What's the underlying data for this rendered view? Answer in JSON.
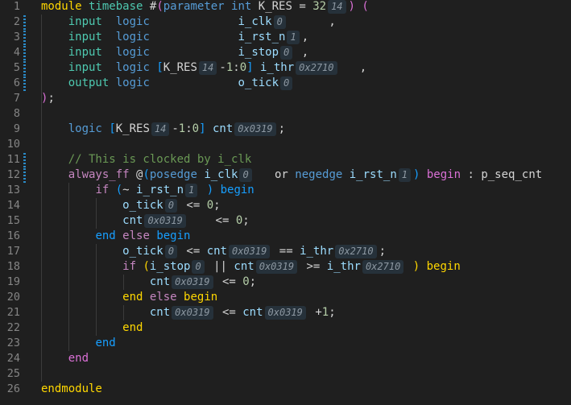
{
  "editor": {
    "language": "systemverilog",
    "colors": {
      "background": "#1f1f1f",
      "line_number": "#858585",
      "keyword": "#569cd6",
      "control": "#c586c0",
      "type": "#4ec9b0",
      "variable": "#9cdcfe",
      "number": "#b5cea8",
      "comment": "#6a9955",
      "bracket1": "#ffd700",
      "bracket2": "#da70d6",
      "bracket3": "#179fff",
      "inlay_hint_bg": "#26313a"
    },
    "modified_lines": [
      2,
      3,
      4,
      5,
      6,
      11,
      12
    ],
    "lines": [
      [
        [
          "b1",
          "module"
        ],
        [
          "p",
          " "
        ],
        [
          "t",
          "timebase"
        ],
        [
          "p",
          " #"
        ],
        [
          "b2",
          "("
        ],
        [
          "k",
          "parameter"
        ],
        [
          "p",
          " "
        ],
        [
          "k",
          "int"
        ],
        [
          "p",
          " K_RES = "
        ],
        [
          "n",
          "32"
        ],
        [
          "h",
          "14"
        ],
        [
          "b2",
          ")"
        ],
        [
          "p",
          " "
        ],
        [
          "b2",
          "("
        ]
      ],
      [
        [
          "p",
          "    "
        ],
        [
          "t",
          "input"
        ],
        [
          "p",
          "  "
        ],
        [
          "k",
          "logic"
        ],
        [
          "p",
          "             "
        ],
        [
          "v",
          "i_clk"
        ],
        [
          "h",
          "0"
        ],
        [
          "p",
          "      ,"
        ]
      ],
      [
        [
          "p",
          "    "
        ],
        [
          "t",
          "input"
        ],
        [
          "p",
          "  "
        ],
        [
          "k",
          "logic"
        ],
        [
          "p",
          "             "
        ],
        [
          "v",
          "i_rst_n"
        ],
        [
          "h",
          "1"
        ],
        [
          "p",
          ","
        ]
      ],
      [
        [
          "p",
          "    "
        ],
        [
          "t",
          "input"
        ],
        [
          "p",
          "  "
        ],
        [
          "k",
          "logic"
        ],
        [
          "p",
          "             "
        ],
        [
          "v",
          "i_stop"
        ],
        [
          "h",
          "0"
        ],
        [
          "p",
          " ,"
        ]
      ],
      [
        [
          "p",
          "    "
        ],
        [
          "t",
          "input"
        ],
        [
          "p",
          "  "
        ],
        [
          "k",
          "logic"
        ],
        [
          "p",
          " "
        ],
        [
          "b3",
          "["
        ],
        [
          "p",
          "K_RES"
        ],
        [
          "h",
          "14"
        ],
        [
          "p",
          "-"
        ],
        [
          "n",
          "1"
        ],
        [
          "p",
          ":"
        ],
        [
          "n",
          "0"
        ],
        [
          "b3",
          "]"
        ],
        [
          "p",
          " "
        ],
        [
          "v",
          "i_thr"
        ],
        [
          "h",
          "0x2710"
        ],
        [
          "p",
          "   ,"
        ]
      ],
      [
        [
          "p",
          "    "
        ],
        [
          "t",
          "output"
        ],
        [
          "p",
          " "
        ],
        [
          "k",
          "logic"
        ],
        [
          "p",
          "             "
        ],
        [
          "v",
          "o_tick"
        ],
        [
          "h",
          "0"
        ]
      ],
      [
        [
          "b2",
          ")"
        ],
        [
          "p",
          ";"
        ]
      ],
      [],
      [
        [
          "p",
          "    "
        ],
        [
          "k",
          "logic"
        ],
        [
          "p",
          " "
        ],
        [
          "b3",
          "["
        ],
        [
          "p",
          "K_RES"
        ],
        [
          "h",
          "14"
        ],
        [
          "p",
          "-"
        ],
        [
          "n",
          "1"
        ],
        [
          "p",
          ":"
        ],
        [
          "n",
          "0"
        ],
        [
          "b3",
          "]"
        ],
        [
          "p",
          " "
        ],
        [
          "v",
          "cnt"
        ],
        [
          "h",
          "0x0319"
        ],
        [
          "p",
          ";"
        ]
      ],
      [],
      [
        [
          "p",
          "    "
        ],
        [
          "c",
          "// This is clocked by i_clk"
        ]
      ],
      [
        [
          "p",
          "    "
        ],
        [
          "kp",
          "always_ff"
        ],
        [
          "p",
          " @"
        ],
        [
          "b3",
          "("
        ],
        [
          "k",
          "posedge"
        ],
        [
          "p",
          " "
        ],
        [
          "v",
          "i_clk"
        ],
        [
          "h",
          "0"
        ],
        [
          "p",
          "   or "
        ],
        [
          "k",
          "negedge"
        ],
        [
          "p",
          " "
        ],
        [
          "v",
          "i_rst_n"
        ],
        [
          "h",
          "1"
        ],
        [
          "b3",
          ")"
        ],
        [
          "p",
          " "
        ],
        [
          "b2",
          "begin"
        ],
        [
          "p",
          " : p_seq_cnt"
        ]
      ],
      [
        [
          "p",
          "        "
        ],
        [
          "kp",
          "if"
        ],
        [
          "p",
          " "
        ],
        [
          "b3",
          "("
        ],
        [
          "p",
          "~ "
        ],
        [
          "v",
          "i_rst_n"
        ],
        [
          "h",
          "1"
        ],
        [
          "p",
          " "
        ],
        [
          "b3",
          ")"
        ],
        [
          "p",
          " "
        ],
        [
          "b3",
          "begin"
        ]
      ],
      [
        [
          "p",
          "            "
        ],
        [
          "v",
          "o_tick"
        ],
        [
          "h",
          "0"
        ],
        [
          "p",
          " <= "
        ],
        [
          "n",
          "0"
        ],
        [
          "p",
          ";"
        ]
      ],
      [
        [
          "p",
          "            "
        ],
        [
          "v",
          "cnt"
        ],
        [
          "h",
          "0x0319"
        ],
        [
          "p",
          "    <= "
        ],
        [
          "n",
          "0"
        ],
        [
          "p",
          ";"
        ]
      ],
      [
        [
          "p",
          "        "
        ],
        [
          "b3",
          "end"
        ],
        [
          "p",
          " "
        ],
        [
          "kp",
          "else"
        ],
        [
          "p",
          " "
        ],
        [
          "b3",
          "begin"
        ]
      ],
      [
        [
          "p",
          "            "
        ],
        [
          "v",
          "o_tick"
        ],
        [
          "h",
          "0"
        ],
        [
          "p",
          " <= "
        ],
        [
          "v",
          "cnt"
        ],
        [
          "h",
          "0x0319"
        ],
        [
          "p",
          " == "
        ],
        [
          "v",
          "i_thr"
        ],
        [
          "h",
          "0x2710"
        ],
        [
          "p",
          ";"
        ]
      ],
      [
        [
          "p",
          "            "
        ],
        [
          "kp",
          "if"
        ],
        [
          "p",
          " "
        ],
        [
          "b1",
          "("
        ],
        [
          "v",
          "i_stop"
        ],
        [
          "h",
          "0"
        ],
        [
          "p",
          " || "
        ],
        [
          "v",
          "cnt"
        ],
        [
          "h",
          "0x0319"
        ],
        [
          "p",
          " >= "
        ],
        [
          "v",
          "i_thr"
        ],
        [
          "h",
          "0x2710"
        ],
        [
          "p",
          " "
        ],
        [
          "b1",
          ")"
        ],
        [
          "p",
          " "
        ],
        [
          "b1",
          "begin"
        ]
      ],
      [
        [
          "p",
          "                "
        ],
        [
          "v",
          "cnt"
        ],
        [
          "h",
          "0x0319"
        ],
        [
          "p",
          " <= "
        ],
        [
          "n",
          "0"
        ],
        [
          "p",
          ";"
        ]
      ],
      [
        [
          "p",
          "            "
        ],
        [
          "b1",
          "end"
        ],
        [
          "p",
          " "
        ],
        [
          "kp",
          "else"
        ],
        [
          "p",
          " "
        ],
        [
          "b1",
          "begin"
        ]
      ],
      [
        [
          "p",
          "                "
        ],
        [
          "v",
          "cnt"
        ],
        [
          "h",
          "0x0319"
        ],
        [
          "p",
          " <= "
        ],
        [
          "v",
          "cnt"
        ],
        [
          "h",
          "0x0319"
        ],
        [
          "p",
          " +"
        ],
        [
          "n",
          "1"
        ],
        [
          "p",
          ";"
        ]
      ],
      [
        [
          "p",
          "            "
        ],
        [
          "b1",
          "end"
        ]
      ],
      [
        [
          "p",
          "        "
        ],
        [
          "b3",
          "end"
        ]
      ],
      [
        [
          "p",
          "    "
        ],
        [
          "b2",
          "end"
        ]
      ],
      [],
      [
        [
          "b1",
          "endmodule"
        ]
      ]
    ]
  }
}
